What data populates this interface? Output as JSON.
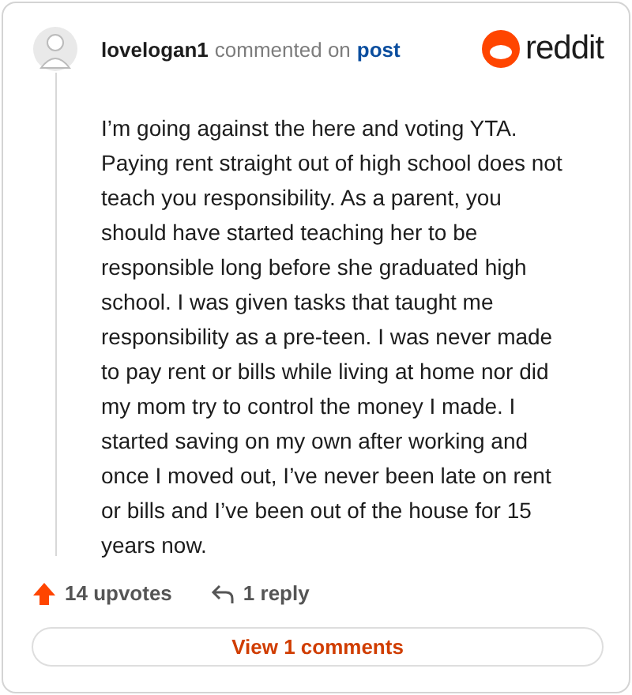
{
  "comment": {
    "author": "lovelogan1",
    "action": "commented on",
    "link": "post",
    "body": "I’m going against the here and voting YTA. Paying rent straight out of high school does not teach you responsibility. As a parent, you should have started teaching her to be responsible long before she graduated high school. I was given tasks that taught me responsibility as a pre-teen. I was never made to pay rent or bills while living at home nor did my mom try to control the money I made. I started saving on my own after working and once I moved out, I’ve never been late on rent or bills and I’ve been out of the house for 15 years now."
  },
  "logo": {
    "wordmark": "reddit"
  },
  "footer": {
    "upvotes": "14 upvotes",
    "replies": "1 reply"
  },
  "button": {
    "label": "View 1 comments"
  }
}
